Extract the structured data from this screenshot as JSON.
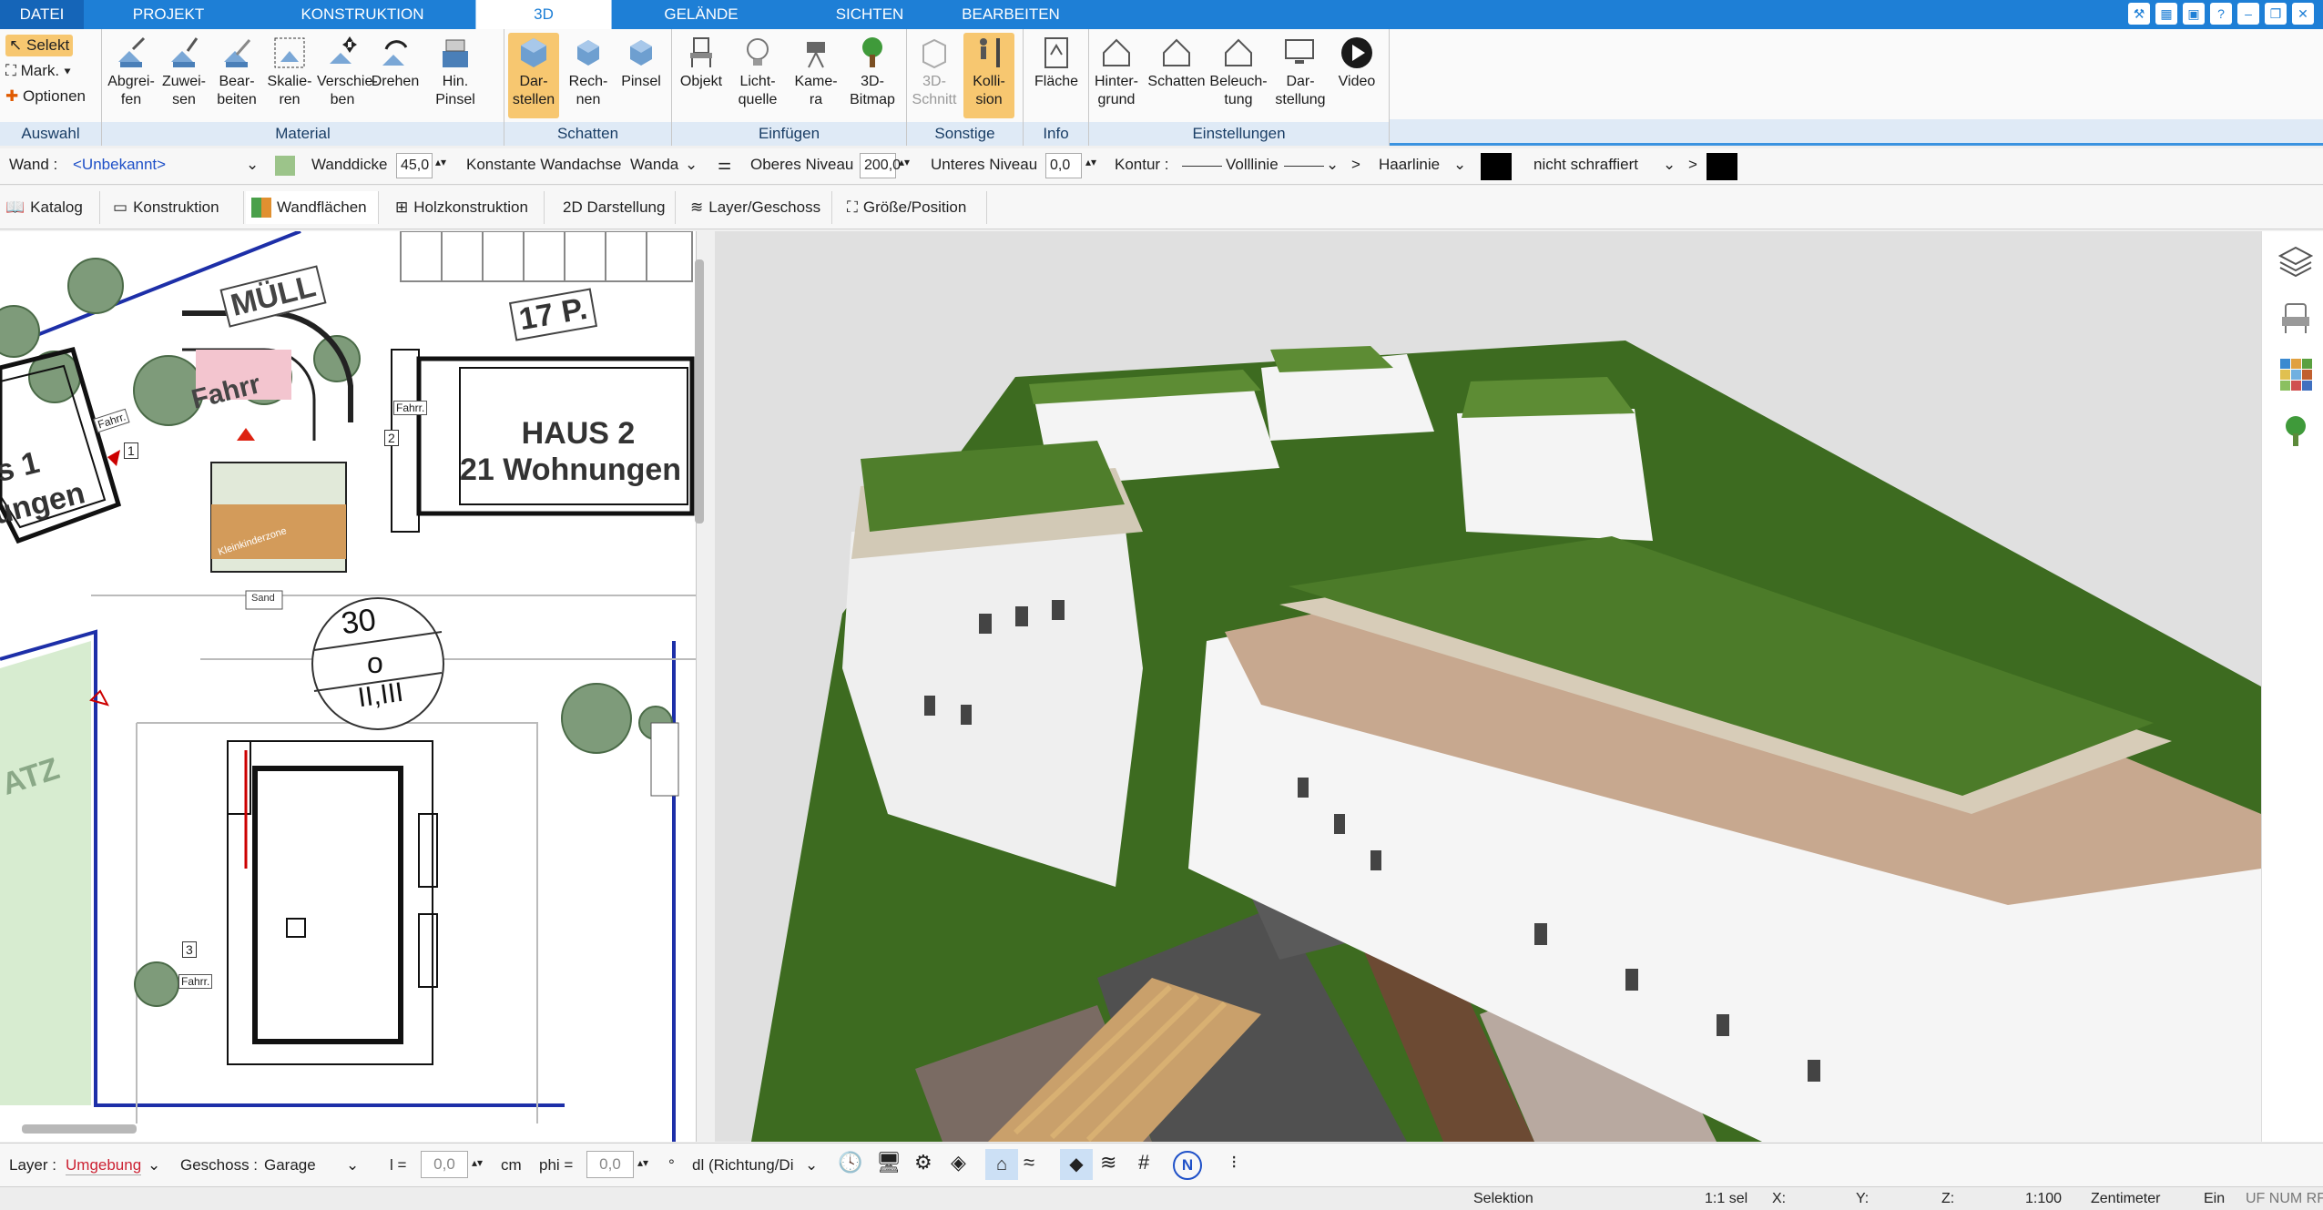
{
  "menu": {
    "tabs": [
      "DATEI",
      "PROJEKT",
      "KONSTRUKTION",
      "3D",
      "GELÄNDE",
      "SICHTEN",
      "BEARBEITEN"
    ],
    "active_tab": "3D"
  },
  "ribbon": {
    "auswahl": {
      "label": "Auswahl",
      "items": [
        "Selekt",
        "Mark.",
        "Optionen"
      ]
    },
    "material": {
      "label": "Material",
      "buttons": [
        "Abgrei-\nfen",
        "Zuwei-\nsen",
        "Bear-\nbeiten",
        "Skalie-\nren",
        "Verschie-\nben",
        "Drehen",
        "Hin.\nPinsel"
      ]
    },
    "schatten": {
      "label": "Schatten",
      "buttons": [
        "Dar-\nstellen",
        "Rech-\nnen",
        "Pinsel"
      ]
    },
    "einfuegen": {
      "label": "Einfügen",
      "buttons": [
        "Objekt",
        "Licht-\nquelle",
        "Kame-\nra",
        "3D-\nBitmap"
      ]
    },
    "sonstige": {
      "label": "Sonstige",
      "buttons": [
        "3D-\nSchnitt",
        "Kolli-\nsion"
      ]
    },
    "info": {
      "label": "Info",
      "buttons": [
        "Fläche"
      ]
    },
    "einstellungen": {
      "label": "Einstellungen",
      "buttons": [
        "Hinter-\ngrund",
        "Schatten",
        "Beleuch-\ntung",
        "Dar-\nstellung",
        "Video"
      ]
    }
  },
  "propbar": {
    "wand_label": "Wand :",
    "wand_value": "<Unbekannt>",
    "wanddicke_label": "Wanddicke",
    "wanddicke_value": "45,0",
    "konst_label": "Konstante Wandachse",
    "konst_value": "Wanda",
    "oberes_label": "Oberes Niveau",
    "oberes_value": "200,0",
    "unteres_label": "Unteres Niveau",
    "unteres_value": "0,0",
    "kontur_label": "Kontur :",
    "kontur_value": "Volllinie",
    "haarlinie": "Haarlinie",
    "schraffur": "nicht schraffiert",
    "arrow": ">"
  },
  "subtabs": [
    "Katalog",
    "Konstruktion",
    "Wandflächen",
    "Holzkonstruktion",
    "2D Darstellung",
    "Layer/Geschoss",
    "Größe/Position"
  ],
  "plan": {
    "muell": "MÜLL",
    "p17": "17 P.",
    "haus2_line1": "HAUS 2",
    "haus2_line2": "21 Wohnungen",
    "haus1_line1": "s 1",
    "haus1_line2": "ungen",
    "fahrr": "Fahrr.",
    "fahrr_big": "Fahrr",
    "kleinkinderzone": "Kleinkinderzone",
    "sand": "Sand",
    "zone_num": "30",
    "zone_o": "o",
    "zone_floors": "II,III",
    "atz": "ATZ",
    "num1": "1",
    "num2": "2",
    "num3": "3"
  },
  "bottombar": {
    "layer_label": "Layer :",
    "layer_value": "Umgebung",
    "geschoss_label": "Geschoss :",
    "geschoss_value": "Garage",
    "l_label": "l =",
    "l_value": "0,0",
    "l_unit": "cm",
    "phi_label": "phi =",
    "phi_value": "0,0",
    "phi_unit": "°",
    "dl_value": "dl (Richtung/Di"
  },
  "status": {
    "mode": "Selektion",
    "scale_sel": "1:1 sel",
    "x": "X:",
    "y": "Y:",
    "z": "Z:",
    "scale": "1:100",
    "unit": "Zentimeter",
    "ein": "Ein",
    "flags": "UF NUM RF"
  },
  "colors": {
    "accent": "#1e7fd6",
    "highlight": "#f7c770",
    "grass": "#3c6a1e",
    "roof": "#4d7a2c"
  }
}
